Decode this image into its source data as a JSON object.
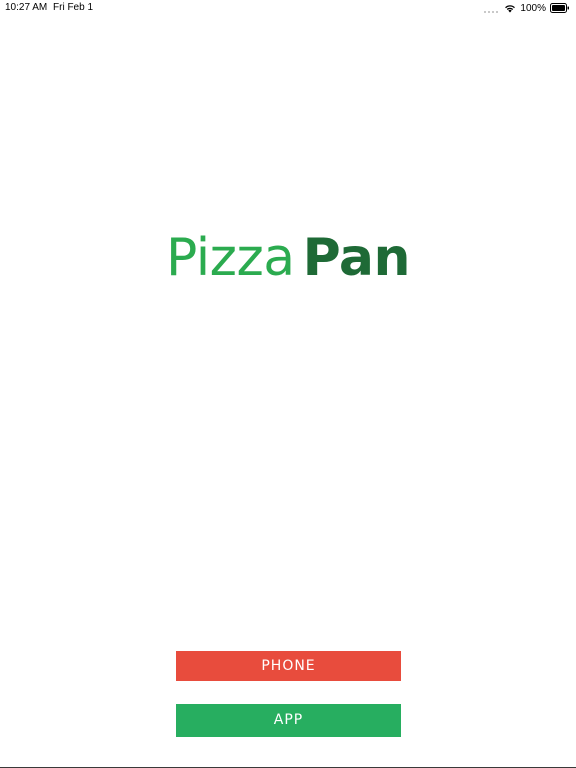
{
  "status_bar": {
    "time": "10:27 AM",
    "date": "Fri Feb 1",
    "battery": "100%",
    "icons": [
      "signal-dots-icon",
      "wifi-icon",
      "battery-icon"
    ]
  },
  "logo": {
    "word_light": "Pizza",
    "word_bold": "Pan",
    "colors": {
      "light": "#2bab4f",
      "bold": "#1e6a36"
    }
  },
  "buttons": {
    "phone": {
      "label": "PHONE",
      "color": "#e84c3d"
    },
    "app": {
      "label": "APP",
      "color": "#27ae60"
    }
  }
}
